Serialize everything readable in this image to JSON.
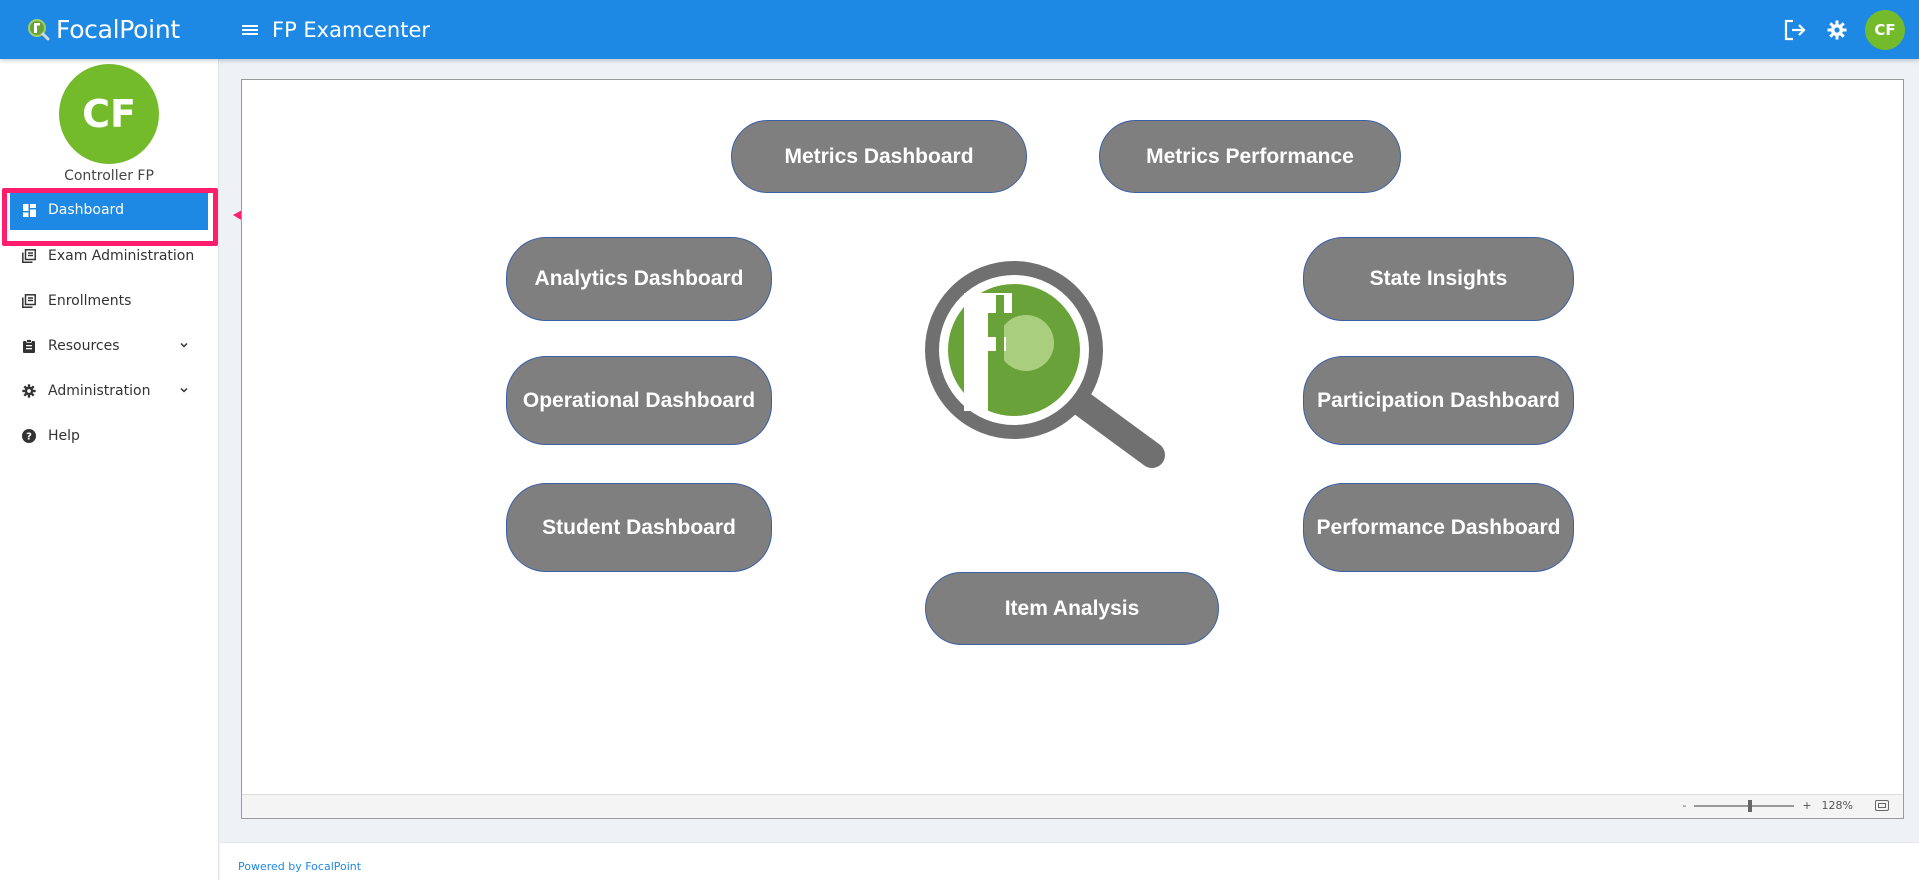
{
  "header": {
    "brand": "FocalPoint",
    "app_title": "FP Examcenter",
    "avatar_initials": "CF"
  },
  "sidebar": {
    "avatar_initials": "CF",
    "username": "Controller FP",
    "items": [
      {
        "label": "Dashboard",
        "icon": "dashboard-icon",
        "active": true
      },
      {
        "label": "Exam Administration",
        "icon": "library-books-icon"
      },
      {
        "label": "Enrollments",
        "icon": "library-books-icon"
      },
      {
        "label": "Resources",
        "icon": "clipboard-icon",
        "expandable": true
      },
      {
        "label": "Administration",
        "icon": "gear-icon",
        "expandable": true
      },
      {
        "label": "Help",
        "icon": "help-circle-icon"
      }
    ]
  },
  "dashboard": {
    "buttons": {
      "metrics_dashboard": "Metrics Dashboard",
      "metrics_performance": "Metrics Performance",
      "analytics_dashboard": "Analytics Dashboard",
      "state_insights": "State Insights",
      "operational_dashboard": "Operational Dashboard",
      "participation_dashboard": "Participation Dashboard",
      "student_dashboard": "Student Dashboard",
      "performance_dashboard": "Performance Dashboard",
      "item_analysis": "Item Analysis"
    },
    "zoom": {
      "minus": "-",
      "plus": "+",
      "level": "128%",
      "level_value": 128
    }
  },
  "footer": {
    "text": "Powered by FocalPoint"
  },
  "colors": {
    "primary": "#1e88e5",
    "avatar": "#74bb2c",
    "button_fill": "#7f7f7f",
    "button_border": "#3b5fa7",
    "annotation": "#ff1e6e",
    "logo_green": "#6aa23a",
    "logo_gray": "#707070"
  }
}
